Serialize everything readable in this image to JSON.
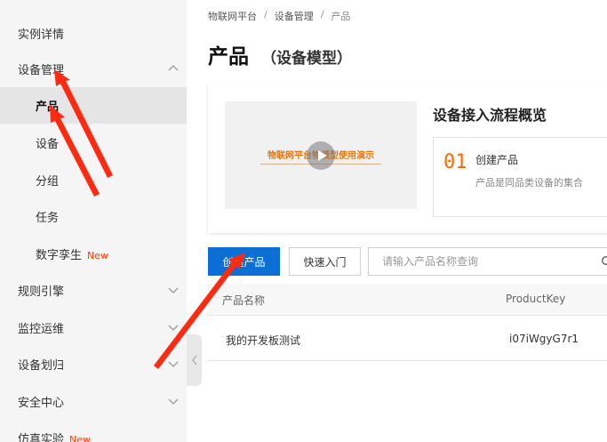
{
  "sidebar": {
    "items": [
      {
        "label": "实例详情"
      },
      {
        "label": "设备管理"
      },
      {
        "label": "产品"
      },
      {
        "label": "设备"
      },
      {
        "label": "分组"
      },
      {
        "label": "任务"
      },
      {
        "label": "数字孪生",
        "badge": "New"
      },
      {
        "label": "规则引擎"
      },
      {
        "label": "监控运维"
      },
      {
        "label": "设备划归"
      },
      {
        "label": "安全中心"
      },
      {
        "label": "仿真实验",
        "badge": "New"
      }
    ],
    "active_item": "产品"
  },
  "breadcrumb": [
    "物联网平台",
    "设备管理",
    "产品"
  ],
  "page": {
    "title": "产品",
    "subtitle": "（设备模型）"
  },
  "overview": {
    "video_title": "物联网平台物模型使用演示",
    "title": "设备接入流程概览",
    "step": {
      "number": "01",
      "title": "创建产品",
      "desc": "产品是同品类设备的集合"
    }
  },
  "toolbar": {
    "create_label": "创建产品",
    "quick_start_label": "快速入门",
    "search_placeholder": "请输入产品名称查询"
  },
  "table": {
    "columns": [
      "产品名称",
      "ProductKey"
    ],
    "rows": [
      {
        "name": "我的开发板测试",
        "key": "i07iWgyG7r1"
      }
    ]
  },
  "colors": {
    "primary": "#0b6fd5",
    "accent": "#ff6a00",
    "new_badge": "#ff3b00",
    "annotation": "#ff2a10"
  }
}
